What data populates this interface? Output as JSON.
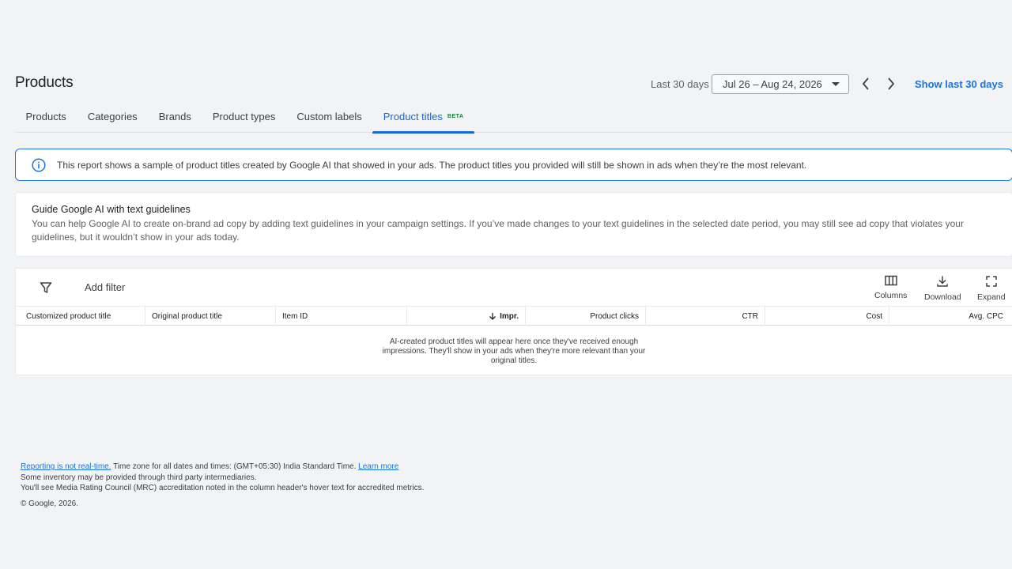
{
  "header": {
    "title": "Products",
    "daterange_label": "Last 30 days",
    "date_range": "Jul 26 – Aug 24, 2026",
    "show_last_label": "Show last 30 days"
  },
  "tabs": [
    {
      "label": "Products"
    },
    {
      "label": "Categories"
    },
    {
      "label": "Brands"
    },
    {
      "label": "Product types"
    },
    {
      "label": "Custom labels"
    },
    {
      "label": "Product titles",
      "badge": "BETA",
      "active": true
    }
  ],
  "info_banner": {
    "icon": "info-icon",
    "text": "This report shows a sample of product titles created by Google AI that showed in your ads. The product titles you provided will still be shown in ads when they’re the most relevant."
  },
  "guide": {
    "title": "Guide Google AI with text guidelines",
    "body": "You can help Google AI to create on-brand ad copy by adding text guidelines in your campaign settings. If you’ve made changes to your text guidelines in the selected date period, you may still see ad copy that violates your guidelines, but it wouldn’t show in your ads today."
  },
  "table": {
    "add_filter": "Add filter",
    "tools": {
      "columns": "Columns",
      "download": "Download",
      "expand": "Expand"
    },
    "columns": [
      {
        "label": "Customized product title"
      },
      {
        "label": "Original product title"
      },
      {
        "label": "Item ID"
      },
      {
        "label": "Impr.",
        "sorted": "desc"
      },
      {
        "label": "Product clicks"
      },
      {
        "label": "CTR"
      },
      {
        "label": "Cost"
      },
      {
        "label": "Avg. CPC"
      }
    ],
    "empty_message": "AI-created product titles will appear here once they've received enough impressions. They'll show in your ads when they're more relevant than your original titles."
  },
  "footer": {
    "realtime_link": "Reporting is not real-time.",
    "timezone_text": " Time zone for all dates and times: (GMT+05:30) India Standard Time. ",
    "learn_more": "Learn more",
    "line2": "Some inventory may be provided through third party intermediaries.",
    "line3": "You'll see Media Rating Council (MRC) accreditation noted in the column header's hover text for accredited metrics.",
    "copyright": "© Google, 2026."
  },
  "colors": {
    "accent": "#1a73e8",
    "active_tab": "#1967d2",
    "beta": "#188038",
    "background": "#f1f3f4"
  }
}
